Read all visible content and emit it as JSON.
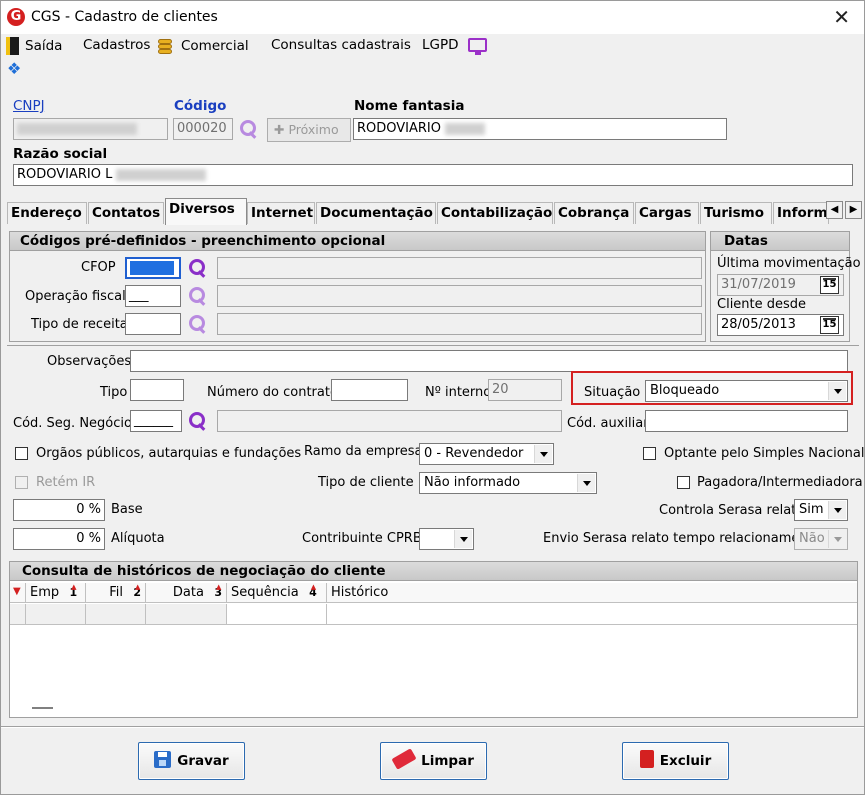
{
  "window": {
    "title": "CGS - Cadastro de clientes",
    "close": "✕"
  },
  "menu": {
    "saida": "Saída",
    "cadastros": "Cadastros",
    "comercial": "Comercial",
    "consultas": "Consultas cadastrais",
    "lgpd": "LGPD"
  },
  "header": {
    "cnpj_label": "CNPJ",
    "codigo_label": "Código",
    "codigo_value": "000020",
    "proximo_label": "✚ Próximo",
    "nome_fantasia_label": "Nome fantasia",
    "nome_fantasia_value": "RODOVIARIO",
    "razao_social_label": "Razão social",
    "razao_social_value": "RODOVIARIO L"
  },
  "tabs": [
    "Endereço",
    "Contatos",
    "Diversos",
    "Internet",
    "Documentação",
    "Contabilização",
    "Cobrança",
    "Cargas",
    "Turismo",
    "Inform"
  ],
  "tab_arrows": {
    "left": "◀",
    "right": "▶"
  },
  "predef": {
    "title": "Códigos pré-definidos - preenchimento opcional",
    "cfop_label": "CFOP",
    "operacao_label": "Operação fiscal",
    "operacao_value": "___",
    "receita_label": "Tipo de receita"
  },
  "datas": {
    "title": "Datas",
    "ultima_label": "Última movimentação",
    "ultima_value": "31/07/2019",
    "desde_label": "Cliente desde",
    "desde_value": "28/05/2013",
    "cal_label": "15"
  },
  "form": {
    "observacoes_label": "Observações",
    "tipo_label": "Tipo",
    "contrato_label": "Número do contrato",
    "interno_label": "Nº interno",
    "interno_value": "20",
    "situacao_label": "Situação",
    "situacao_value": "Bloqueado",
    "seg_label": "Cód. Seg. Negócio",
    "seg_value": "______",
    "auxiliar_label": "Cód. auxiliar",
    "orgaos_label": "Orgãos públicos, autarquias e fundações",
    "ramo_label": "Ramo da empresa",
    "ramo_value": "0 - Revendedor",
    "simples_label": "Optante pelo Simples Nacional",
    "retem_label": "Retém IR",
    "tipo_cliente_label": "Tipo de cliente",
    "tipo_cliente_value": "Não informado",
    "pagadora_label": "Pagadora/Intermediadora",
    "base_value": "0 %",
    "base_label": "Base",
    "serasa_label": "Controla Serasa relato",
    "serasa_value": "Sim",
    "aliquota_value": "0 %",
    "aliquota_label": "Alíquota",
    "cprb_label": "Contribuinte CPRB",
    "envio_label": "Envio Serasa relato tempo relacionamento",
    "envio_value": "Não"
  },
  "historico": {
    "title": "Consulta de históricos de negociação do cliente",
    "columns": [
      {
        "label": "Emp",
        "badge": "1"
      },
      {
        "label": "Fil",
        "badge": "2"
      },
      {
        "label": "Data",
        "badge": "3"
      },
      {
        "label": "Sequência",
        "badge": "4"
      },
      {
        "label": "Histórico",
        "badge": ""
      }
    ]
  },
  "actions": {
    "gravar": "Gravar",
    "limpar": "Limpar",
    "excluir": "Excluir"
  },
  "colors": {
    "highlight": "#d42020",
    "link": "#1a3fc0",
    "accent": "#8a2fc8"
  }
}
